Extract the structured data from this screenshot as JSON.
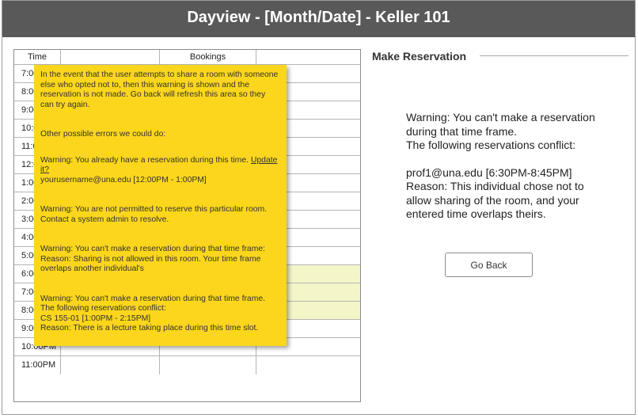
{
  "header": {
    "title": "Dayview - [Month/Date] - Keller 101"
  },
  "grid": {
    "col_time": "Time",
    "col_bookings": "Bookings",
    "rows": [
      {
        "time": "7:00AM",
        "highlight": false
      },
      {
        "time": "8:00AM",
        "highlight": false
      },
      {
        "time": "9:00AM",
        "highlight": false
      },
      {
        "time": "10:00AM",
        "highlight": false
      },
      {
        "time": "11:00AM",
        "highlight": false
      },
      {
        "time": "12:00PM",
        "highlight": false
      },
      {
        "time": "1:00PM",
        "highlight": false
      },
      {
        "time": "2:00PM",
        "highlight": false
      },
      {
        "time": "3:00PM",
        "highlight": false
      },
      {
        "time": "4:00PM",
        "highlight": false
      },
      {
        "time": "5:00PM",
        "highlight": false
      },
      {
        "time": "6:00PM",
        "highlight": true
      },
      {
        "time": "7:00PM",
        "highlight": true
      },
      {
        "time": "8:00PM",
        "highlight": true
      },
      {
        "time": "9:00PM",
        "highlight": false
      },
      {
        "time": "10:00PM",
        "highlight": false
      },
      {
        "time": "11:00PM",
        "highlight": false
      }
    ]
  },
  "note": {
    "p1": "In the event that the user attempts to share a room with someone else who opted not to, then this warning is shown and the reservation is not made. Go back will refresh this area so they can try again.",
    "p2": "Other possible errors we could do:",
    "p3_text": "Warning: You already have a reservation during this time. ",
    "p3_link": "Update it?",
    "p3_detail": "yourusername@una.edu [12:00PM - 1:00PM]",
    "p4": "Warning: You are not permitted to reserve this particular room. Contact a system admin to resolve.",
    "p5_line1": "Warning: You can't make a reservation during that time frame:",
    "p5_line2": "Reason: Sharing is not allowed in this room. Your time frame overlaps another individual's",
    "p6_line1": "Warning: You can't make a reservation during that time frame.",
    "p6_line2": "The following reservations conflict:",
    "p6_line3": "CS 155-01 [1:00PM - 2:15PM]",
    "p6_line4": "Reason: There is a lecture taking place during this time slot."
  },
  "panel": {
    "title": "Make Reservation",
    "warning_line1": "Warning: You can't make a reservation during that time frame.",
    "warning_line2": "The following reservations conflict:",
    "conflict": "prof1@una.edu [6:30PM-8:45PM]",
    "reason": "Reason: This individual chose not to allow sharing of the room, and your entered time overlaps theirs.",
    "go_back_label": "Go Back"
  },
  "colors": {
    "titlebar": "#595959",
    "note": "#fbd61c",
    "highlight": "#f5f6c8"
  }
}
